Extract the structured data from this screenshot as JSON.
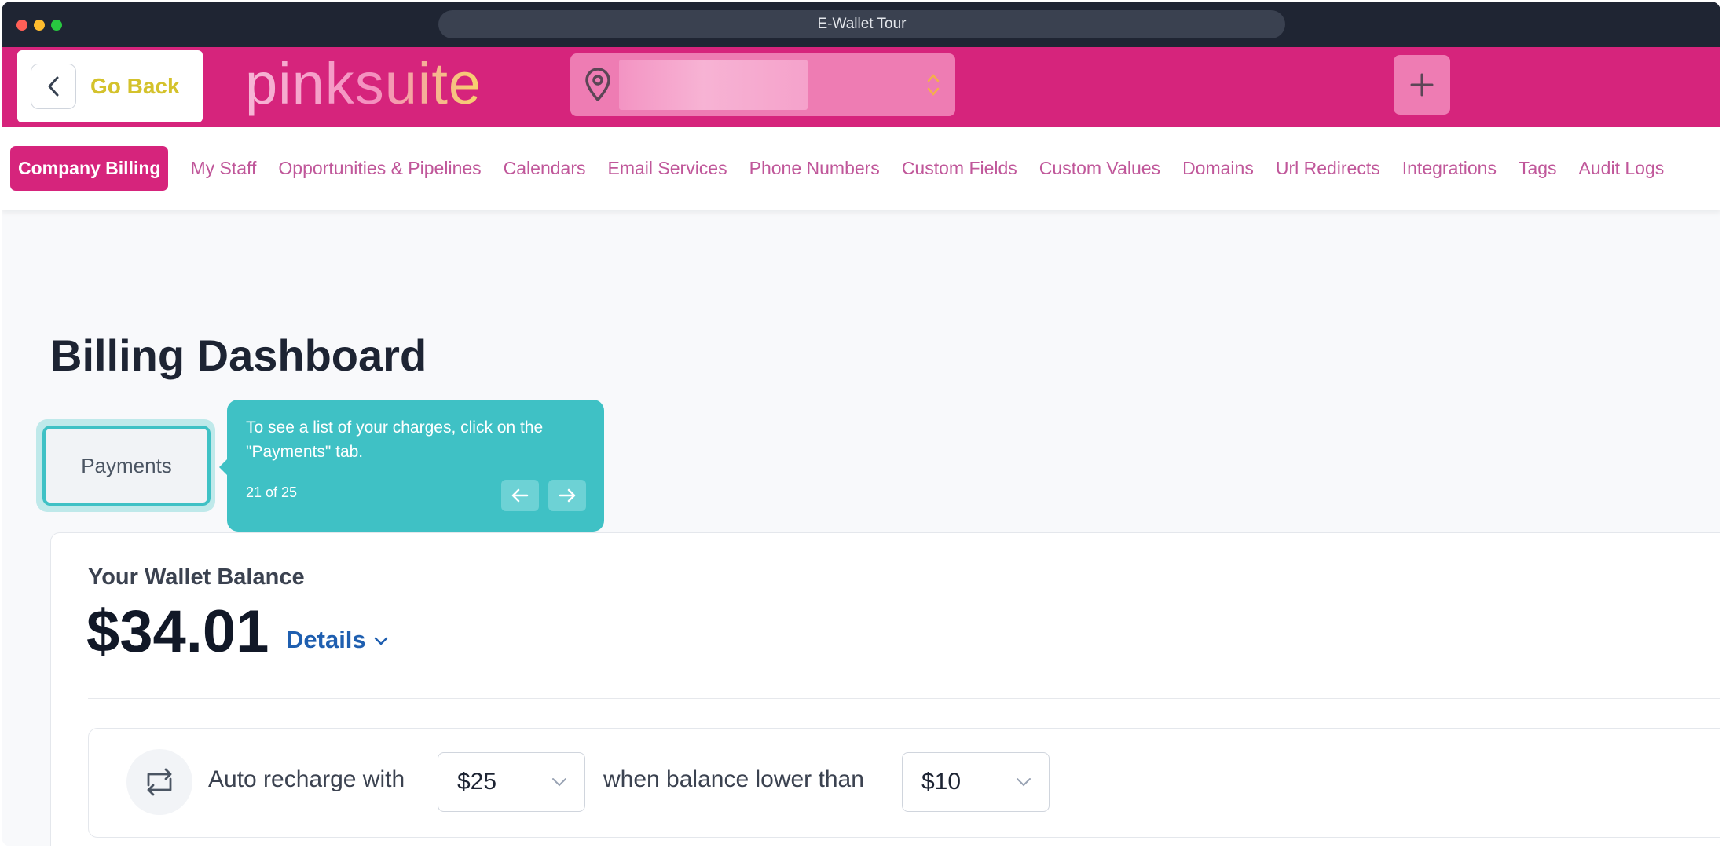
{
  "window": {
    "title": "E-Wallet Tour"
  },
  "header": {
    "go_back_label": "Go Back",
    "logo_text": "pinksuite",
    "brand_color": "#d6247c"
  },
  "nav": {
    "items": [
      {
        "label": "Company Billing",
        "active": true
      },
      {
        "label": "My Staff"
      },
      {
        "label": "Opportunities & Pipelines"
      },
      {
        "label": "Calendars"
      },
      {
        "label": "Email Services"
      },
      {
        "label": "Phone Numbers"
      },
      {
        "label": "Custom Fields"
      },
      {
        "label": "Custom Values"
      },
      {
        "label": "Domains"
      },
      {
        "label": "Url Redirects"
      },
      {
        "label": "Integrations"
      },
      {
        "label": "Tags"
      },
      {
        "label": "Audit Logs"
      }
    ]
  },
  "page": {
    "title": "Billing Dashboard"
  },
  "tabs": {
    "payments_label": "Payments"
  },
  "tour": {
    "text": "To see a list of your charges, click on the \"Payments\" tab.",
    "step": "21 of 25",
    "accent": "#3fc1c5"
  },
  "wallet": {
    "label": "Your Wallet Balance",
    "amount": "$34.01",
    "details_label": "Details"
  },
  "auto_recharge": {
    "prefix": "Auto recharge with",
    "amount": "$25",
    "middle": "when balance lower than",
    "threshold": "$10"
  }
}
